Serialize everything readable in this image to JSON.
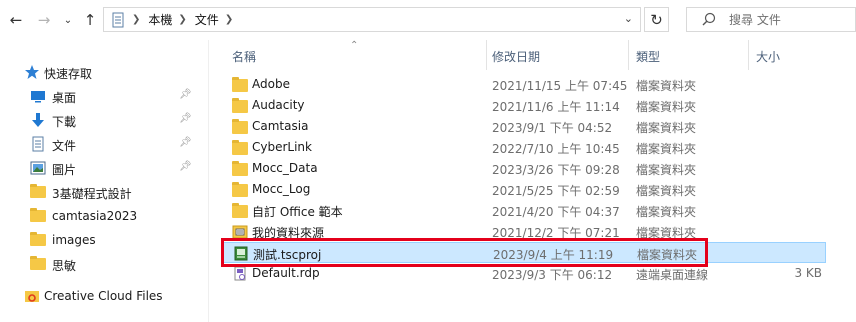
{
  "address": {
    "crumbs": [
      "本機",
      "文件"
    ],
    "search_placeholder": "搜尋 文件"
  },
  "nav": {
    "quick_access": "快速存取",
    "items": [
      {
        "label": "桌面",
        "icon": "desktop-icon",
        "pinned": true
      },
      {
        "label": "下載",
        "icon": "download-icon",
        "pinned": true
      },
      {
        "label": "文件",
        "icon": "document-icon",
        "pinned": true
      },
      {
        "label": "圖片",
        "icon": "picture-icon",
        "pinned": true
      },
      {
        "label": "3基礎程式設計",
        "icon": "folder-icon",
        "pinned": false
      },
      {
        "label": "camtasia2023",
        "icon": "folder-icon",
        "pinned": false
      },
      {
        "label": "images",
        "icon": "folder-icon",
        "pinned": false
      },
      {
        "label": "思敏",
        "icon": "folder-icon",
        "pinned": false
      }
    ],
    "creative_cloud": "Creative Cloud Files"
  },
  "columns": {
    "name": "名稱",
    "modified": "修改日期",
    "type": "類型",
    "size": "大小"
  },
  "files": [
    {
      "name": "Adobe",
      "modified": "2021/11/15 上午 07:45",
      "type": "檔案資料夾",
      "size": "",
      "icon": "folder-icon"
    },
    {
      "name": "Audacity",
      "modified": "2021/11/6 上午 11:14",
      "type": "檔案資料夾",
      "size": "",
      "icon": "folder-icon"
    },
    {
      "name": "Camtasia",
      "modified": "2023/9/1 下午 04:52",
      "type": "檔案資料夾",
      "size": "",
      "icon": "folder-icon"
    },
    {
      "name": "CyberLink",
      "modified": "2022/7/10 上午 10:45",
      "type": "檔案資料夾",
      "size": "",
      "icon": "folder-icon"
    },
    {
      "name": "Mocc_Data",
      "modified": "2023/3/26 下午 09:28",
      "type": "檔案資料夾",
      "size": "",
      "icon": "folder-icon"
    },
    {
      "name": "Mocc_Log",
      "modified": "2021/5/25 下午 02:59",
      "type": "檔案資料夾",
      "size": "",
      "icon": "folder-icon"
    },
    {
      "name": "自訂 Office 範本",
      "modified": "2021/4/20 下午 04:37",
      "type": "檔案資料夾",
      "size": "",
      "icon": "folder-icon"
    },
    {
      "name": "我的資料來源",
      "modified": "2021/12/2 下午 07:21",
      "type": "檔案資料夾",
      "size": "",
      "icon": "data-source-folder-icon"
    },
    {
      "name": "測試.tscproj",
      "modified": "2023/9/4 上午 11:19",
      "type": "檔案資料夾",
      "size": "",
      "icon": "tscproj-icon",
      "selected": true
    },
    {
      "name": "Default.rdp",
      "modified": "2023/9/3 下午 06:12",
      "type": "遠端桌面連線",
      "size": "3 KB",
      "icon": "rdp-file-icon"
    }
  ],
  "colors": {
    "selection": "#cce8ff",
    "highlight_box": "#e4001b",
    "folder": "#f5c846"
  }
}
